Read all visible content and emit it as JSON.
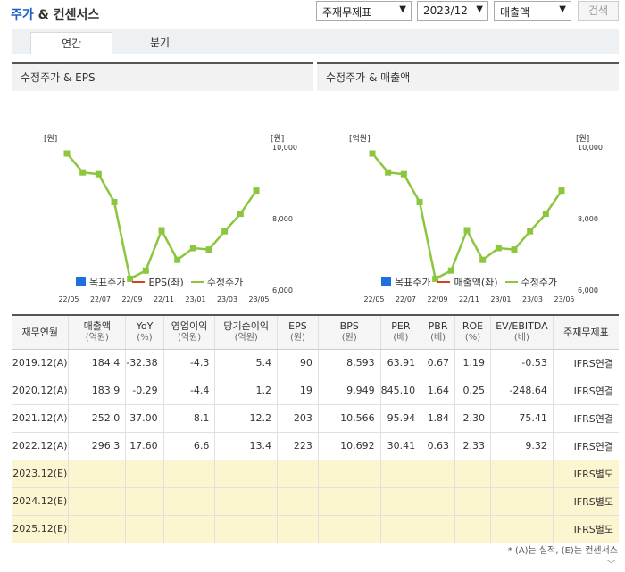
{
  "header": {
    "title_part1": "주가",
    "title_part2": " & 컨센서스",
    "select_report": "주재무제표",
    "select_period": "2023/12",
    "select_metric": "매출액",
    "search_label": "검색"
  },
  "tabs": [
    {
      "label": "연간"
    },
    {
      "label": "분기"
    }
  ],
  "chart_data": [
    {
      "type": "line",
      "title": "수정주가 & EPS",
      "left_unit": "[원]",
      "right_unit": "[원]",
      "x_ticks": [
        "22/05",
        "22/07",
        "22/09",
        "22/11",
        "23/01",
        "23/03",
        "23/05"
      ],
      "ylim": [
        6000,
        10000
      ],
      "y_ticks": [
        "6,000",
        "8,000",
        "10,000"
      ],
      "legend": [
        "목표주가",
        "EPS(좌)",
        "수정주가"
      ],
      "series": [
        {
          "name": "수정주가",
          "color": "#8cc63f",
          "values": [
            9800,
            9270,
            9220,
            8440,
            6290,
            6520,
            7650,
            6820,
            7150,
            7110,
            7620,
            8110,
            8760
          ]
        }
      ]
    },
    {
      "type": "line",
      "title": "수정주가 & 매출액",
      "left_unit": "[억원]",
      "right_unit": "[원]",
      "x_ticks": [
        "22/05",
        "22/07",
        "22/09",
        "22/11",
        "23/01",
        "23/03",
        "23/05"
      ],
      "ylim": [
        6000,
        10000
      ],
      "y_ticks": [
        "6,000",
        "8,000",
        "10,000"
      ],
      "legend": [
        "목표주가",
        "매출액(좌)",
        "수정주가"
      ],
      "series": [
        {
          "name": "수정주가",
          "color": "#8cc63f",
          "values": [
            9800,
            9270,
            9220,
            8440,
            6290,
            6520,
            7650,
            6820,
            7150,
            7110,
            7620,
            8110,
            8760
          ]
        }
      ]
    }
  ],
  "legend_colors": {
    "target": "#1f6fe0",
    "eps": "#d9401f",
    "price": "#8cc63f"
  },
  "table": {
    "headers": [
      {
        "label": "재무연월",
        "unit": ""
      },
      {
        "label": "매출액",
        "unit": "(억원)"
      },
      {
        "label": "YoY",
        "unit": "(%)"
      },
      {
        "label": "영업이익",
        "unit": "(억원)"
      },
      {
        "label": "당기순이익",
        "unit": "(억원)"
      },
      {
        "label": "EPS",
        "unit": "(원)"
      },
      {
        "label": "BPS",
        "unit": "(원)"
      },
      {
        "label": "PER",
        "unit": "(배)"
      },
      {
        "label": "PBR",
        "unit": "(배)"
      },
      {
        "label": "ROE",
        "unit": "(%)"
      },
      {
        "label": "EV/EBITDA",
        "unit": "(배)"
      },
      {
        "label": "주재무제표",
        "unit": ""
      }
    ],
    "rows": [
      [
        "2019.12(A)",
        "184.4",
        "-32.38",
        "-4.3",
        "5.4",
        "90",
        "8,593",
        "63.91",
        "0.67",
        "1.19",
        "-0.53",
        "IFRS연결"
      ],
      [
        "2020.12(A)",
        "183.9",
        "-0.29",
        "-4.4",
        "1.2",
        "19",
        "9,949",
        "845.10",
        "1.64",
        "0.25",
        "-248.64",
        "IFRS연결"
      ],
      [
        "2021.12(A)",
        "252.0",
        "37.00",
        "8.1",
        "12.2",
        "203",
        "10,566",
        "95.94",
        "1.84",
        "2.30",
        "75.41",
        "IFRS연결"
      ],
      [
        "2022.12(A)",
        "296.3",
        "17.60",
        "6.6",
        "13.4",
        "223",
        "10,692",
        "30.41",
        "0.63",
        "2.33",
        "9.32",
        "IFRS연결"
      ],
      [
        "2023.12(E)",
        "",
        "",
        "",
        "",
        "",
        "",
        "",
        "",
        "",
        "",
        "IFRS별도"
      ],
      [
        "2024.12(E)",
        "",
        "",
        "",
        "",
        "",
        "",
        "",
        "",
        "",
        "",
        "IFRS별도"
      ],
      [
        "2025.12(E)",
        "",
        "",
        "",
        "",
        "",
        "",
        "",
        "",
        "",
        "",
        "IFRS별도"
      ]
    ]
  },
  "footnote": "* (A)는 실적, (E)는 컨센서스",
  "more_icon": "chevron-down-icon"
}
